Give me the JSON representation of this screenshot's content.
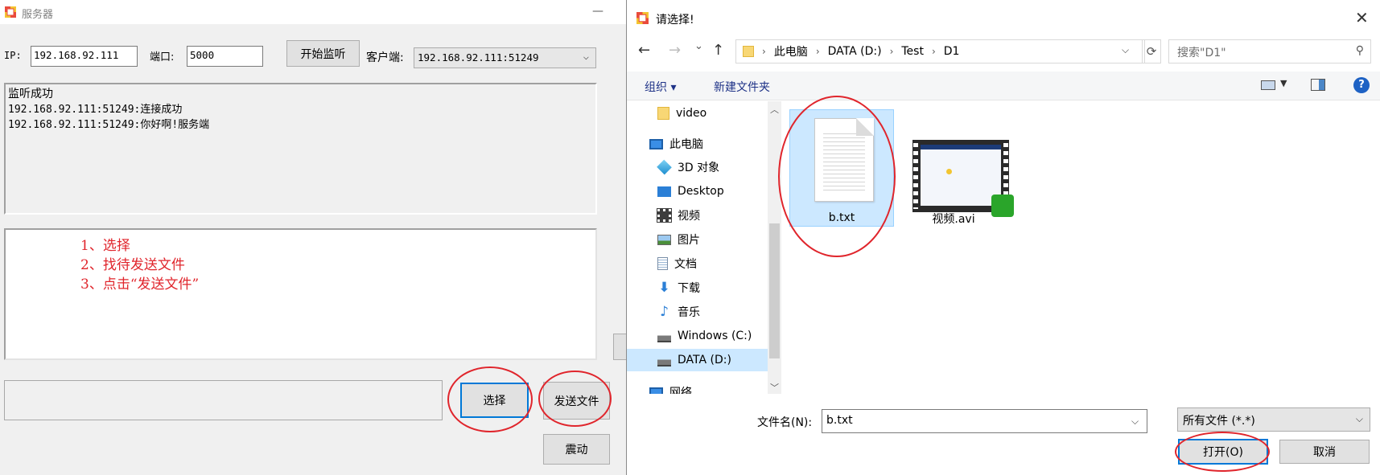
{
  "colors": {
    "accent": "#0078d7",
    "annotation": "#e0252c",
    "selection": "#cce8ff"
  },
  "server": {
    "title": "服务器",
    "minimize_glyph": "—",
    "ip_label": "IP:",
    "ip_value": "192.168.92.111",
    "port_label": "端口:",
    "port_value": "5000",
    "listen_button": "开始监听",
    "client_label": "客户端:",
    "client_value": "192.168.92.111:51249",
    "log_lines": [
      "监听成功",
      "192.168.92.111:51249:连接成功",
      "192.168.92.111:51249:你好啊!服务端"
    ],
    "annotation_lines": [
      "1、选择",
      "2、找待发送文件",
      "3、点击“发送文件”"
    ],
    "choose_button": "选择",
    "send_button": "发送文件",
    "shake_button": "震动"
  },
  "dialog": {
    "title": "请选择!",
    "close_glyph": "✕",
    "nav": {
      "back": "←",
      "forward": "→",
      "recent": "⌄",
      "up": "↑"
    },
    "breadcrumb": [
      "此电脑",
      "DATA (D:)",
      "Test",
      "D1"
    ],
    "search_placeholder": "搜索\"D1\"",
    "toolbar": {
      "organize": "组织 ▾",
      "new_folder": "新建文件夹",
      "help": "?"
    },
    "tree": [
      {
        "label": "video",
        "icon": "folder-icon"
      },
      {
        "label": "此电脑",
        "icon": "computer-icon"
      },
      {
        "label": "3D 对象",
        "icon": "3d-objects-icon"
      },
      {
        "label": "Desktop",
        "icon": "desktop-icon"
      },
      {
        "label": "视频",
        "icon": "videos-icon"
      },
      {
        "label": "图片",
        "icon": "pictures-icon"
      },
      {
        "label": "文档",
        "icon": "documents-icon"
      },
      {
        "label": "下载",
        "icon": "downloads-icon"
      },
      {
        "label": "音乐",
        "icon": "music-icon"
      },
      {
        "label": "Windows (C:)",
        "icon": "drive-icon"
      },
      {
        "label": "DATA (D:)",
        "icon": "drive-icon"
      },
      {
        "label": "网络",
        "icon": "network-icon"
      }
    ],
    "files": [
      {
        "name": "b.txt",
        "icon": "text-file-icon",
        "selected": true
      },
      {
        "name": "视频.avi",
        "icon": "video-file-icon",
        "selected": false
      }
    ],
    "filename_label": "文件名(N):",
    "filename_value": "b.txt",
    "filetype_value": "所有文件 (*.*)",
    "open_button": "打开(O)",
    "cancel_button": "取消"
  }
}
